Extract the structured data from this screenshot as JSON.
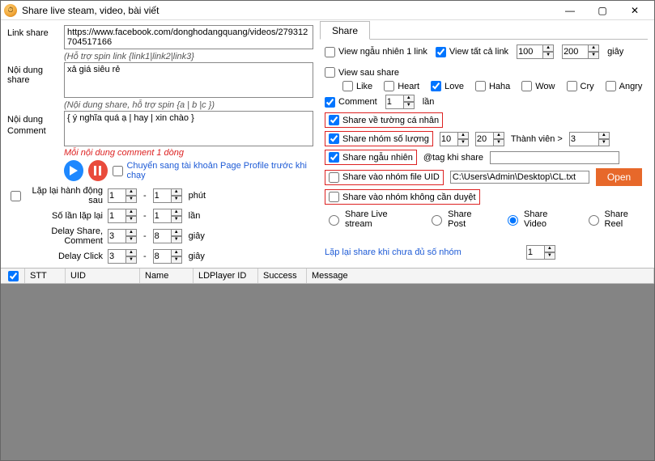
{
  "window": {
    "title": "Share live steam, video, bài viết",
    "min": "—",
    "max": "▢",
    "close": "✕"
  },
  "left": {
    "linkShareLabel": "Link share",
    "linkShareValue": "https://www.facebook.com/donghodangquang/videos/279312704517166",
    "spinHint": "(Hỗ trợ spin link {link1|link2|link3}",
    "contentShareLabel": "Nội dung share",
    "contentShareValue": "xả giá siêu rẻ",
    "commentHint": "(Nội dung share, hỗ trợ spin {a | b |c })",
    "commentLabel": "Nội dung Comment",
    "commentValue": "{ ý nghĩa quá ạ | hay | xin chào }",
    "oneLineHint": "Mỗi nội dung comment 1 dòng",
    "switchAccount": "Chuyển sang tài khoản Page Profile trước khi chạy",
    "repeatLabel": "Lặp lại hành động sau",
    "repeatA": "1",
    "repeatB": "1",
    "repeatUnit": "phút",
    "countLabel": "Số lần lặp lại",
    "countA": "1",
    "countB": "1",
    "countUnit": "lần",
    "delaySCLabel": "Delay Share, Comment",
    "delaySCA": "3",
    "delaySCB": "8",
    "delaySCUnit": "giây",
    "delayClickLabel": "Delay Click",
    "delayClickA": "3",
    "delayClickB": "8",
    "delayClickUnit": "giây"
  },
  "right": {
    "tab": "Share",
    "viewRandom": "View ngẫu nhiên 1 link",
    "viewAll": "View tất cả link",
    "vNumA": "100",
    "vNumB": "200",
    "vUnit": "giây",
    "viewAfter": "View sau share",
    "like": "Like",
    "heart": "Heart",
    "love": "Love",
    "haha": "Haha",
    "wow": "Wow",
    "cry": "Cry",
    "angry": "Angry",
    "comment": "Comment",
    "commentN": "1",
    "commentUnit": "lần",
    "sharePersonal": "Share về tường cá nhân",
    "shareGroup": "Share nhóm số lượng",
    "sgA": "10",
    "sgB": "20",
    "memberGt": "Thành viên >",
    "memberN": "3",
    "shareRandom": "Share ngẫu nhiên",
    "tagLabel": "@tag khi share",
    "tagValue": "",
    "shareFile": "Share vào nhóm file  UID",
    "filePath": "C:\\Users\\Admin\\Desktop\\CL.txt",
    "openBtn": "Open",
    "shareNoReview": "Share vào nhóm không cần duyệt",
    "rLive": "Share Live stream",
    "rPost": "Share Post",
    "rVideo": "Share Video",
    "rReel": "Share Reel",
    "repeatShareLabel": "Lặp lại share khi chưa đủ số nhóm",
    "repeatShareN": "1"
  },
  "grid": {
    "stt": "STT",
    "uid": "UID",
    "name": "Name",
    "ld": "LDPlayer ID",
    "success": "Success",
    "message": "Message"
  }
}
